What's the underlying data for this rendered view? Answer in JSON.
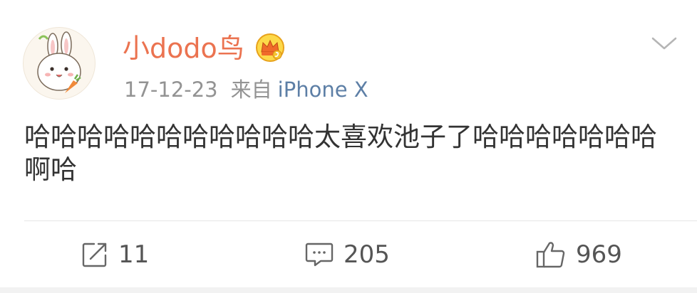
{
  "post": {
    "author": "小dodo鸟",
    "date": "17-12-23",
    "from_label": "来自",
    "device": "iPhone X",
    "text": "哈哈哈哈哈哈哈哈哈哈哈太喜欢池子了哈哈哈哈哈哈哈啊哈"
  },
  "actions": {
    "reposts": "11",
    "comments": "205",
    "likes": "969"
  },
  "icons": {
    "avatar": "rabbit-avatar-icon",
    "badge": "vip-crown-badge-icon",
    "menu": "chevron-down-icon",
    "repost": "repost-icon",
    "comment": "comment-icon",
    "like": "thumbs-up-icon"
  },
  "colors": {
    "username": "#eb7350",
    "device_link": "#5d7fa6",
    "meta": "#939393",
    "text": "#333333"
  }
}
